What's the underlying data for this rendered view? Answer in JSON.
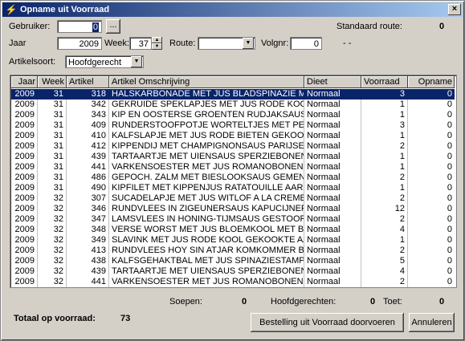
{
  "window": {
    "title": "Opname uit Voorraad",
    "close_glyph": "×"
  },
  "form": {
    "gebruiker_label": "Gebruiker:",
    "gebruiker_value": "0",
    "browse_label": "...",
    "standaard_route_label": "Standaard route:",
    "standaard_route_value": "0",
    "jaar_label": "Jaar",
    "jaar_value": "2009",
    "week_label": "Week:",
    "week_value": "37",
    "route_label": "Route:",
    "route_value": "",
    "volgnr_label": "Volgnr:",
    "volgnr_value": "0",
    "dash_text": "-  -",
    "artikelsoort_label": "Artikelsoort:",
    "artikelsoort_value": "Hoofdgerecht"
  },
  "table": {
    "columns": [
      "Jaar",
      "Week",
      "Artikel",
      "Artikel Omschrijving",
      "Dieet",
      "Voorraad",
      "Opname"
    ],
    "rows": [
      [
        "2009",
        "31",
        "318",
        "HALSKARBONADE MET JUS BLADSPINAZIE M",
        "Normaal",
        "3",
        "0"
      ],
      [
        "2009",
        "31",
        "342",
        "GEKRUIDE SPEKLAPJES MET JUS RODE KOO",
        "Normaal",
        "1",
        "0"
      ],
      [
        "2009",
        "31",
        "343",
        "KIP EN OOSTERSE GROENTEN RUDJAKSAUS",
        "Normaal",
        "1",
        "0"
      ],
      [
        "2009",
        "31",
        "409",
        "RUNDERSTOOFPOTJE WORTELTJES MET PE",
        "Normaal",
        "3",
        "0"
      ],
      [
        "2009",
        "31",
        "410",
        "KALFSLAPJE MET JUS RODE BIETEN GEKOOK",
        "Normaal",
        "1",
        "0"
      ],
      [
        "2009",
        "31",
        "412",
        "KIPPENDIJ MET CHAMPIGNONSAUS PARIJSE",
        "Normaal",
        "2",
        "0"
      ],
      [
        "2009",
        "31",
        "439",
        "TARTAARTJE MET UIENSAUS SPERZIEBONEN",
        "Normaal",
        "1",
        "0"
      ],
      [
        "2009",
        "31",
        "441",
        "VARKENSOESTER MET JUS ROMANOBONEN",
        "Normaal",
        "1",
        "0"
      ],
      [
        "2009",
        "31",
        "486",
        "GEPOCH. ZALM MET BIESLOOKSAUS GEMENG",
        "Normaal",
        "2",
        "0"
      ],
      [
        "2009",
        "31",
        "490",
        "KIPFILET MET KIPPENJUS RATATOUILLE AAR",
        "Normaal",
        "1",
        "0"
      ],
      [
        "2009",
        "32",
        "307",
        "SUCADELAPJE MET JUS WITLOF A LA CREME",
        "Normaal",
        "2",
        "0"
      ],
      [
        "2009",
        "32",
        "346",
        "RUNDVLEES IN ZIGEUNERSAUS KAPUCIJNER",
        "Normaal",
        "12",
        "0"
      ],
      [
        "2009",
        "32",
        "347",
        "LAMSVLEES IN HONING-TIJMSAUS GESTOOF",
        "Normaal",
        "2",
        "0"
      ],
      [
        "2009",
        "32",
        "348",
        "VERSE WORST MET JUS BLOEMKOOL MET BE",
        "Normaal",
        "4",
        "0"
      ],
      [
        "2009",
        "32",
        "349",
        "SLAVINK MET JUS RODE KOOL GEKOOKTE AA",
        "Normaal",
        "1",
        "0"
      ],
      [
        "2009",
        "32",
        "413",
        "RUNDVLEES HOY SIN ATJAR KOMKOMMER BA",
        "Normaal",
        "2",
        "0"
      ],
      [
        "2009",
        "32",
        "438",
        "KALFSGEHAKTBAL MET JUS SPINAZIESTAMP",
        "Normaal",
        "5",
        "0"
      ],
      [
        "2009",
        "32",
        "439",
        "TARTAARTJE MET UIENSAUS SPERZIEBONEN",
        "Normaal",
        "4",
        "0"
      ],
      [
        "2009",
        "32",
        "441",
        "VARKENSOESTER MET JUS ROMANOBONEN",
        "Normaal",
        "2",
        "0"
      ]
    ]
  },
  "summary": {
    "soepen_label": "Soepen:",
    "soepen_value": "0",
    "hoofdgerechten_label": "Hoofdgerechten:",
    "hoofdgerechten_value": "0",
    "toet_label": "Toet:",
    "toet_value": "0",
    "totaal_label": "Totaal op voorraad:",
    "totaal_value": "73"
  },
  "buttons": {
    "bestelling_label": "Bestelling uit Voorraad doorvoeren",
    "annuleren_label": "Annuleren"
  },
  "colors": {
    "title_start": "#0a246a",
    "title_end": "#a6caf0",
    "selection": "#0a246a",
    "face": "#d4d0c8"
  }
}
